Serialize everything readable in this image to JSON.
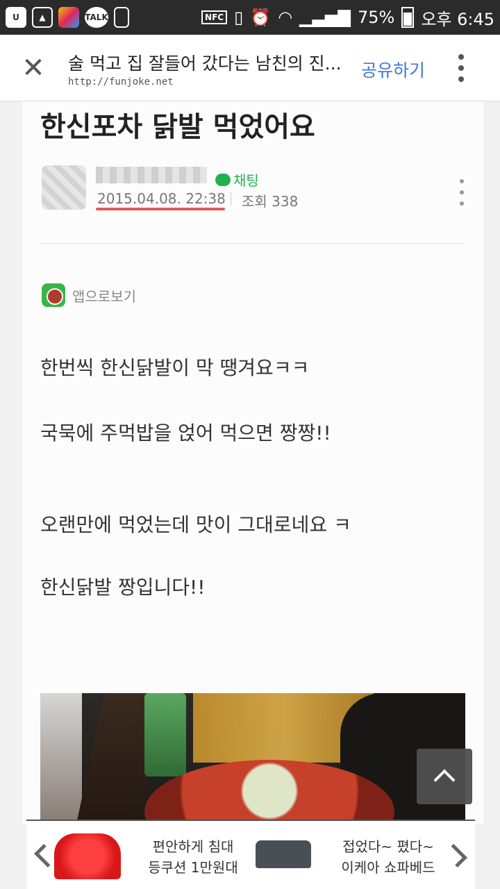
{
  "status_bar": {
    "icons": [
      "u-plus-icon",
      "gallery-icon",
      "app-icon",
      "kakaotalk-icon",
      "phone-icon"
    ],
    "talk_label": "TALK",
    "nfc_label": "NFC",
    "battery_text": "75%",
    "battery_level": 0.75,
    "time": "오후 6:45"
  },
  "top_bar": {
    "title": "술 먹고 집 잘들어 갔다는 남친의 진...",
    "url": "http://funjoke.net",
    "share_label": "공유하기"
  },
  "post": {
    "title": "한신포차 닭발 먹었어요",
    "chat_label": "채팅",
    "date": "2015.04.08. 22:38",
    "views": "조회 338",
    "app_view_label": "앱으로보기",
    "paragraphs": [
      "한번씩 한신닭발이 막 땡겨요ㅋㅋ",
      "국묵에 주먹밥을 얹어 먹으면 짱짱!!",
      "오랜만에 먹었는데 맛이 그대로네요 ㅋ",
      "한신닭발 짱입니다!!"
    ]
  },
  "ad": {
    "item1": "편안하게 침대\n등쿠션 1만원대",
    "item2": "접었다~ 폈다~\n이케아 쇼파베드"
  },
  "colors": {
    "accent": "#3a7bd5",
    "chat_green": "#22b14c",
    "underline_red": "#e05a5a"
  }
}
